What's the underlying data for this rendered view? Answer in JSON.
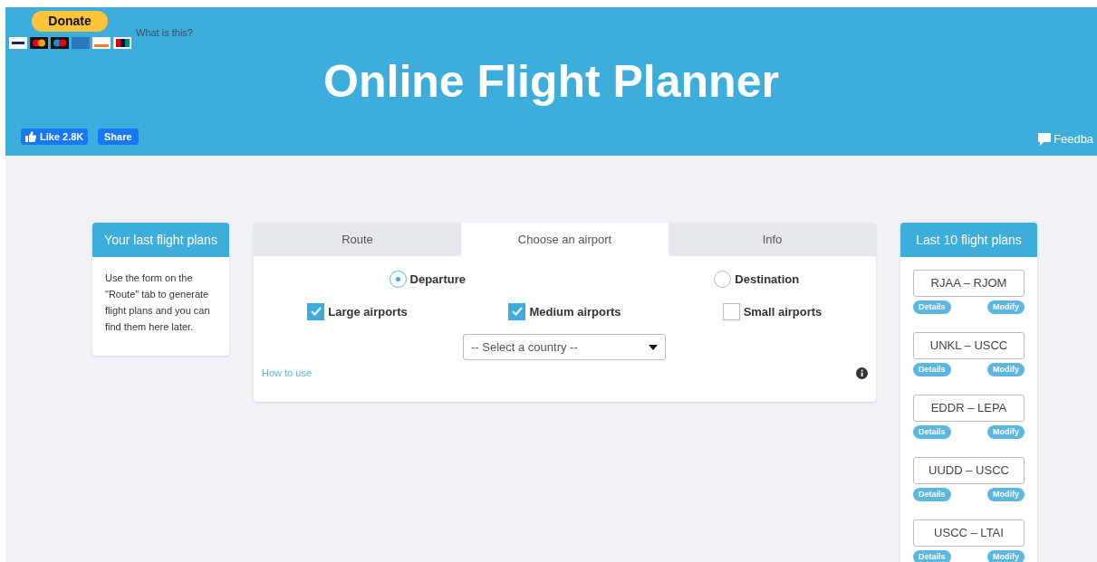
{
  "header": {
    "donate_button": "Donate",
    "what_is_this": "What is this?",
    "title": "Online Flight Planner",
    "like_button": "Like 2.8K",
    "share_button": "Share",
    "feedback": "Feedba"
  },
  "last_plans_card": {
    "title": "Your last flight plans",
    "text": "Use the form on the \"Route\" tab to generate flight plans and you can find them here later."
  },
  "tabs": [
    {
      "label": "Route",
      "selected": false
    },
    {
      "label": "Choose an airport",
      "selected": true
    },
    {
      "label": "Info",
      "selected": false
    }
  ],
  "radios": [
    {
      "label": "Departure",
      "selected": true
    },
    {
      "label": "Destination",
      "selected": false
    }
  ],
  "checkboxes": [
    {
      "label": "Large airports",
      "checked": true
    },
    {
      "label": "Medium airports",
      "checked": true
    },
    {
      "label": "Small airports",
      "checked": false
    }
  ],
  "country_select": {
    "value": "-- Select a country --"
  },
  "how_to_use": "How to use",
  "recent_card": {
    "title": "Last 10 flight plans",
    "plans": [
      {
        "route": "RJAA – RJOM",
        "details": "Details",
        "modify": "Modify"
      },
      {
        "route": "UNKL – USCC",
        "details": "Details",
        "modify": "Modify"
      },
      {
        "route": "EDDR – LEPA",
        "details": "Details",
        "modify": "Modify"
      },
      {
        "route": "UUDD – USCC",
        "details": "Details",
        "modify": "Modify"
      },
      {
        "route": "USCC – LTAI",
        "details": "Details",
        "modify": "Modify"
      }
    ]
  }
}
